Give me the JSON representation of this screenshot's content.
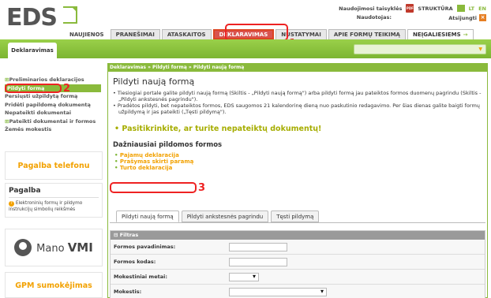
{
  "header": {
    "logo": "EDS",
    "meta": {
      "user_guide": "Naudojimosi taisyklės",
      "structure": "STRUKTŪRA",
      "lang_lt": "LT",
      "lang_en": "EN",
      "user_label": "Naudotojas:",
      "logout": "Atsijungti"
    },
    "tabs": [
      "NAUJIENOS",
      "PRANEŠIMAI",
      "ATASKAITOS",
      "DEKLARAVIMAS",
      "NUSTATYMAI",
      "APIE FORMŲ TEIKIMĄ"
    ],
    "special_tab": "NEĮGALIESIEMS"
  },
  "greenbar": {
    "section_tab": "Deklaravimas"
  },
  "sidebar": {
    "items": [
      "Preliminarios deklaracijos",
      "Pildyti formą",
      "Persiųsti užpildytą formą",
      "Pridėti papildomą dokumentą",
      "Nepateikti dokumentai",
      "Pateikti dokumentai ir formos",
      "Žemės mokestis"
    ],
    "help_phone": "Pagalba telefonu",
    "help_title": "Pagalba",
    "help_text": "Elektroninių formų ir pildymo instrukcijų simbolių reikšmės",
    "mano_vmi_a": "Mano",
    "mano_vmi_b": "VMI",
    "gpm": "GPM sumokėjimas"
  },
  "main": {
    "breadcrumb": "Deklaravimas » Pildyti formą » Pildyti naują formą",
    "title": "Pildyti naują formą",
    "bullets": [
      "Tiesiogiai portale galite pildyti naują formą (Skiltis - „Pildyti naują formą\") arba pildyti formą jau pateiktos formos duomenų pagrindu (Skiltis - „Pildyti ankstesnės pagrindu\").",
      "Pradėtos pildyti, bet nepateiktos formos, EDS saugomos 21 kalendorinę dieną nuo paskutinio redagavimo. Per šias dienas galite baigti formų užpildymą ir jas pateikti („Tęsti pildymą\")."
    ],
    "check_docs": "Pasitikrinkite, ar turite nepateiktų dokumentų!",
    "freq_title": "Dažniausiai pildomos formos",
    "freq_items": [
      "Pajamų deklaracija",
      "Prašymas skirti paramą",
      "Turto deklaracija"
    ],
    "form_tabs": [
      "Pildyti naują formą",
      "Pildyti ankstesnės pagrindu",
      "Tęsti pildymą"
    ],
    "filter": {
      "title": "Filtras",
      "rows": [
        "Formos pavadinimas:",
        "Formos kodas:",
        "Mokestiniai metai:",
        "Mokestis:"
      ]
    }
  },
  "annotations": [
    "1",
    "2",
    "3"
  ]
}
